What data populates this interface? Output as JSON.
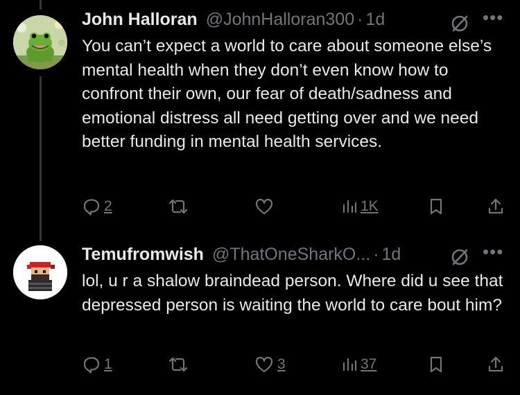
{
  "tweets": [
    {
      "name": "John Halloran",
      "handle": "@JohnHalloran300",
      "separator": "·",
      "time": "1d",
      "avatar_icon": "frog-avatar",
      "more_icon": "•••",
      "text": "You can’t expect a world to care about someone else’s mental health when they don’t even know how to confront their own, our fear of death/sadness and emotional distress all need getting over and we need better funding in mental health services.",
      "replies": "2",
      "retweets": "",
      "likes": "",
      "views": "1K"
    },
    {
      "name": "Temufromwish",
      "handle": "@ThatOneSharkO...",
      "separator": "·",
      "time": "1d",
      "avatar_icon": "pixel-character-avatar",
      "more_icon": "•••",
      "text": "lol, u r a shalow braindead person. Where did u see that depressed person is waiting the world to care bout him?",
      "replies": "1",
      "retweets": "",
      "likes": "3",
      "views": "37"
    }
  ],
  "colors": {
    "background": "#000000",
    "text": "#e7e9ea",
    "secondary": "#71767b",
    "thread_line": "#333639"
  }
}
